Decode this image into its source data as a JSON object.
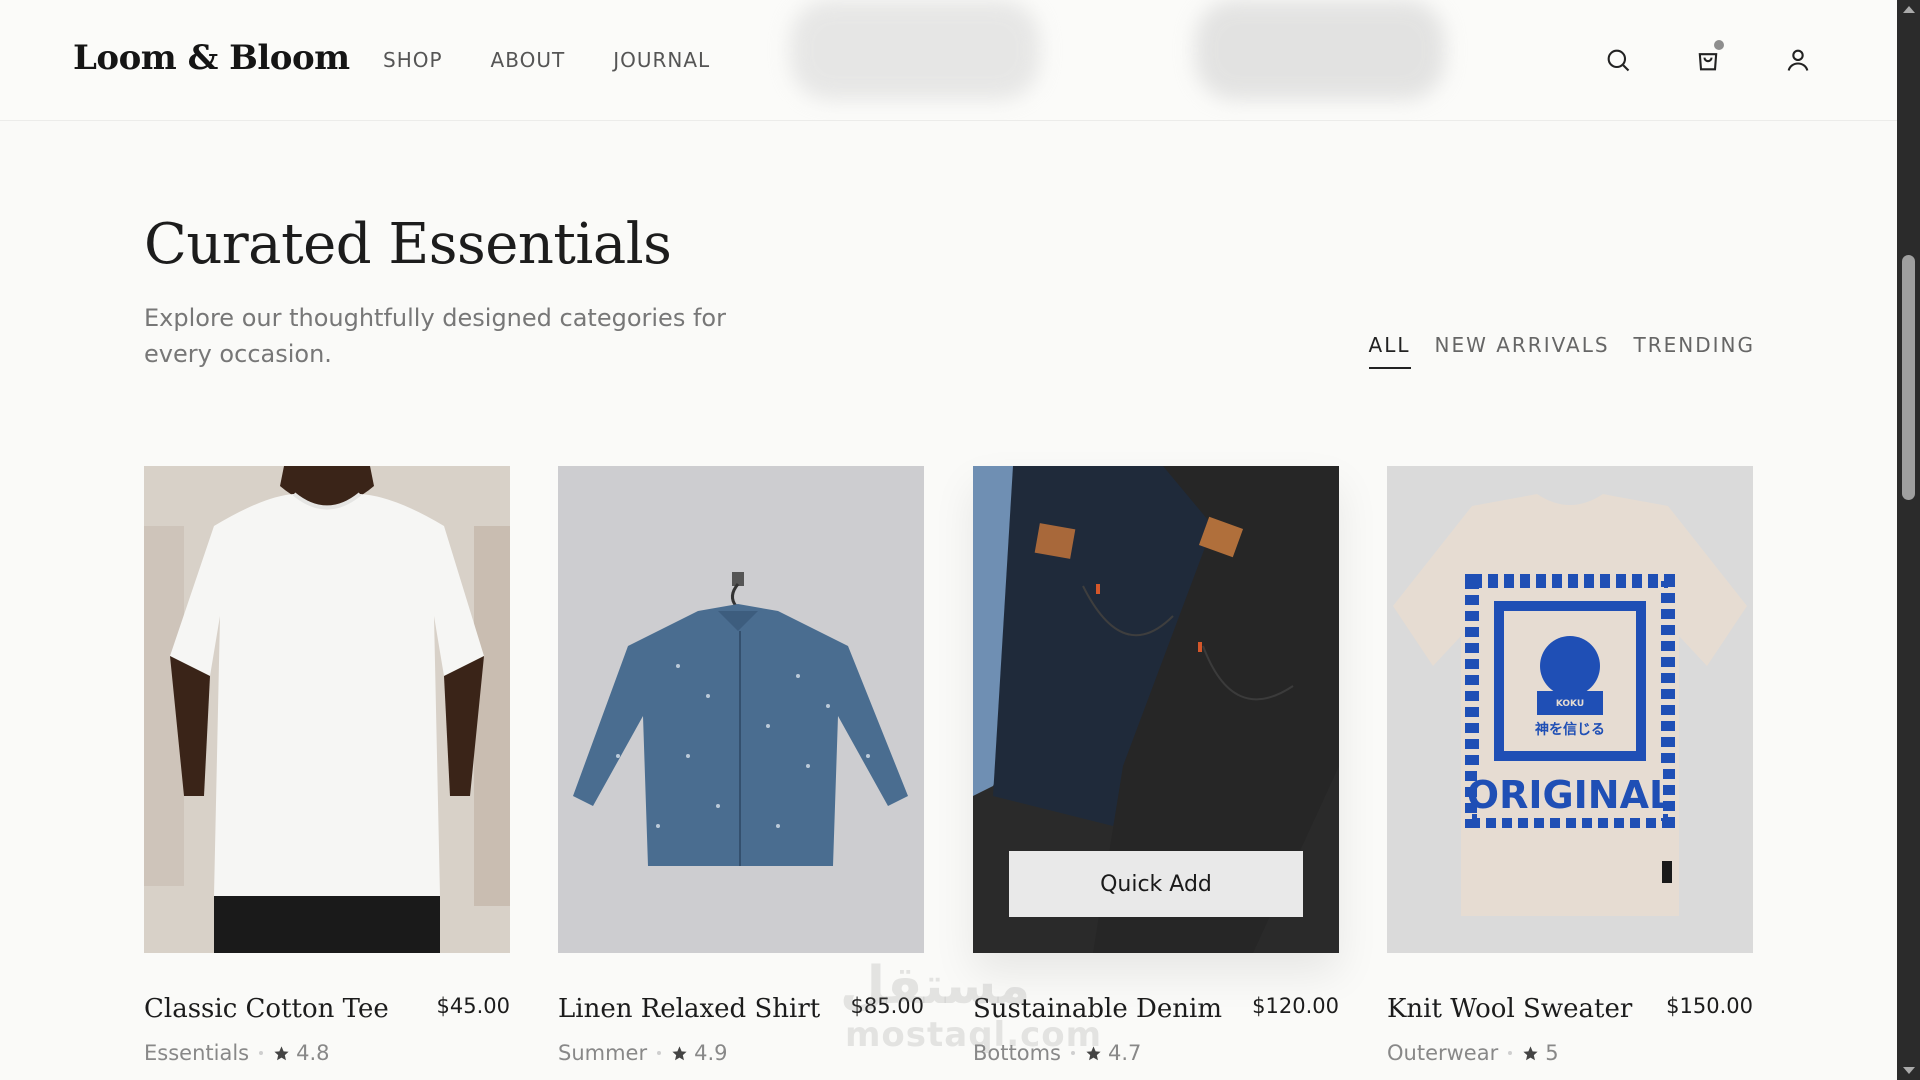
{
  "header": {
    "logo": "Loom & Bloom",
    "nav": [
      "SHOP",
      "ABOUT",
      "JOURNAL"
    ]
  },
  "section": {
    "title": "Curated Essentials",
    "subtitle": "Explore our thoughtfully designed categories for every occasion.",
    "filters": [
      "ALL",
      "NEW ARRIVALS",
      "TRENDING"
    ],
    "active_filter": "ALL"
  },
  "products": [
    {
      "name": "Classic Cotton Tee",
      "price": "$45.00",
      "category": "Essentials",
      "rating": "4.8",
      "image": "white-tee-photo"
    },
    {
      "name": "Linen Relaxed Shirt",
      "price": "$85.00",
      "category": "Summer",
      "rating": "4.9",
      "image": "denim-shirt-photo"
    },
    {
      "name": "Sustainable Denim",
      "price": "$120.00",
      "category": "Bottoms",
      "rating": "4.7",
      "image": "jeans-photo",
      "quick_add": "Quick Add"
    },
    {
      "name": "Knit Wool Sweater",
      "price": "$150.00",
      "category": "Outerwear",
      "rating": "5",
      "image": "graphic-tee-photo",
      "print_top": "KOKU",
      "print_jp": "神を信じる",
      "print_bottom": "ORIGINAL"
    }
  ],
  "watermark": {
    "arabic": "مستقل",
    "latin": "mostaql.com"
  },
  "colors": {
    "background": "#fafaf8",
    "text": "#1a1a1a",
    "muted": "#888888",
    "accent_blue": "#1f4fb5"
  }
}
